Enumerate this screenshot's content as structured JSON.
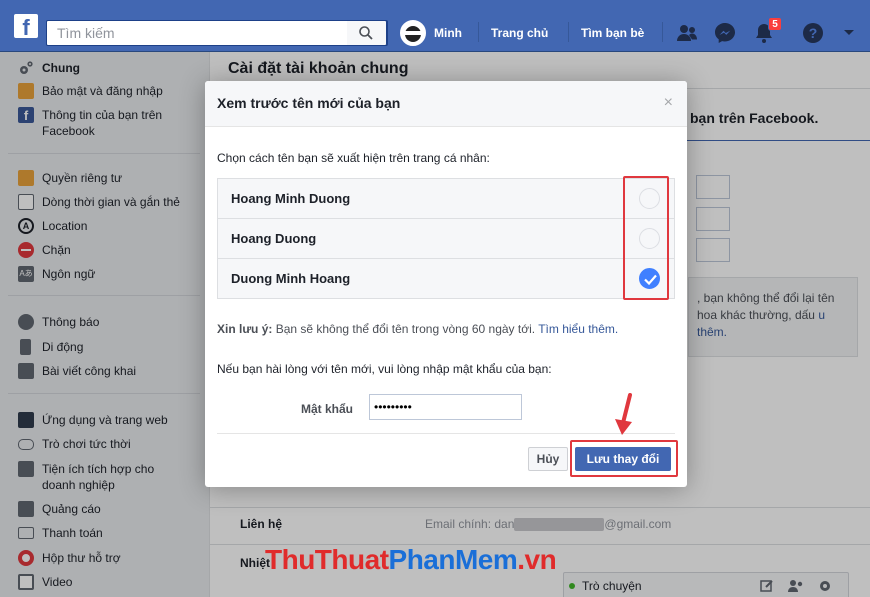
{
  "topbar": {
    "logo": "f",
    "search_placeholder": "Tìm kiếm",
    "user_name": "Minh",
    "nav_home": "Trang chủ",
    "nav_find_friends": "Tìm bạn bè",
    "notifications_count": "5"
  },
  "sidebar": {
    "items": [
      {
        "label": "Chung",
        "icon": "gear-icon"
      },
      {
        "label": "Bảo mật và đăng nhập",
        "icon": "shield-icon"
      },
      {
        "label": "Thông tin của bạn trên Facebook",
        "icon": "facebook-icon"
      },
      {
        "label": "Quyền riêng tư",
        "icon": "lock-icon"
      },
      {
        "label": "Dòng thời gian và gắn thẻ",
        "icon": "timeline-icon"
      },
      {
        "label": "Location",
        "icon": "location-icon"
      },
      {
        "label": "Chặn",
        "icon": "block-icon"
      },
      {
        "label": "Ngôn ngữ",
        "icon": "language-icon"
      },
      {
        "label": "Thông báo",
        "icon": "globe-icon"
      },
      {
        "label": "Di động",
        "icon": "mobile-icon"
      },
      {
        "label": "Bài viết công khai",
        "icon": "rss-icon"
      },
      {
        "label": "Ứng dụng và trang web",
        "icon": "apps-icon"
      },
      {
        "label": "Trò chơi tức thời",
        "icon": "gamepad-icon"
      },
      {
        "label": "Tiện ích tích hợp cho doanh nghiệp",
        "icon": "business-integrations-icon"
      },
      {
        "label": "Quảng cáo",
        "icon": "ads-icon"
      },
      {
        "label": "Thanh toán",
        "icon": "payment-card-icon"
      },
      {
        "label": "Hộp thư hỗ trợ",
        "icon": "support-inbox-icon"
      },
      {
        "label": "Video",
        "icon": "video-icon"
      }
    ]
  },
  "main": {
    "title": "Cài đặt tài khoản chung",
    "fb_name_heading": "bạn trên Facebook.",
    "note_text": ", bạn không thể đổi lại tên hoa khác thường, dấu",
    "note_link": "u thêm.",
    "contact_label": "Liên hệ",
    "contact_value_prefix": "Email chính: dan",
    "contact_value_suffix": "@gmail.com",
    "partial_row_label": "Nhiệt"
  },
  "modal": {
    "title": "Xem trước tên mới của bạn",
    "close": "×",
    "prompt": "Chọn cách tên bạn sẽ xuất hiện trên trang cá nhân:",
    "options": [
      {
        "label": "Hoang Minh Duong",
        "checked": false
      },
      {
        "label": "Hoang Duong",
        "checked": false
      },
      {
        "label": "Duong Minh Hoang",
        "checked": true
      }
    ],
    "note_bold": "Xin lưu ý:",
    "note_text": " Bạn sẽ không thể đổi tên trong vòng 60 ngày tới. ",
    "note_link": "Tìm hiểu thêm.",
    "password_prompt": "Nếu bạn hài lòng với tên mới, vui lòng nhập mật khẩu của bạn:",
    "password_label": "Mật khẩu",
    "password_value": "•••••••••",
    "cancel_label": "Hủy",
    "save_label": "Lưu thay đổi"
  },
  "chat": {
    "label": "Trò chuyện"
  },
  "watermark": {
    "part1": "ThuThuat",
    "part2": "PhanMem",
    "part3": ".vn"
  },
  "colors": {
    "brand": "#4267b2",
    "highlight": "#e0383e",
    "checked": "#4080ff"
  }
}
